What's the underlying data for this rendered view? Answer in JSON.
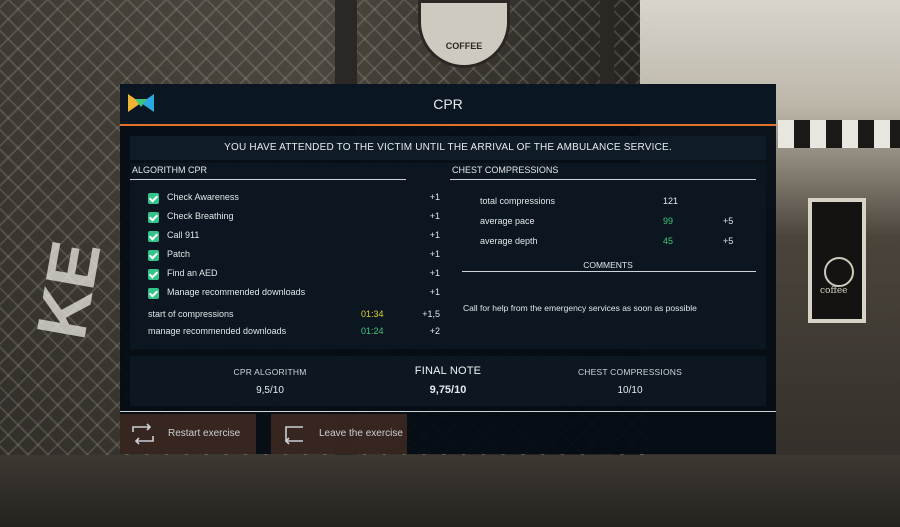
{
  "dialog": {
    "title": "CPR",
    "banner": "YOU HAVE ATTENDED TO THE VICTIM UNTIL THE ARRIVAL OF THE AMBULANCE SERVICE."
  },
  "algorithm": {
    "heading": "ALGORITHM CPR",
    "checks": [
      {
        "label": "Check Awareness",
        "points": "+1"
      },
      {
        "label": "Check Breathing",
        "points": "+1"
      },
      {
        "label": "Call 911",
        "points": "+1"
      },
      {
        "label": "Patch",
        "points": "+1"
      },
      {
        "label": "Find an AED",
        "points": "+1"
      },
      {
        "label": "Manage recommended downloads",
        "points": "+1"
      }
    ],
    "timings": [
      {
        "label": "start of compressions",
        "time": "01:34",
        "points": "+1,5",
        "color": "#e0d030"
      },
      {
        "label": "manage recommended downloads",
        "time": "01:24",
        "points": "+2",
        "color": "#3ec77a"
      }
    ]
  },
  "compressions": {
    "heading": "CHEST COMPRESSIONS",
    "rows": [
      {
        "label": "total compressions",
        "value": "121",
        "points": "",
        "color": "#e2e6e9"
      },
      {
        "label": "average pace",
        "value": "99",
        "points": "+5",
        "color": "#3ec77a"
      },
      {
        "label": "average depth",
        "value": "45",
        "points": "+5",
        "color": "#3ec77a"
      }
    ],
    "comments_heading": "COMMENTS",
    "comment": "Call for help from the emergency services as soon as possible"
  },
  "summary": {
    "algorithm_label": "CPR ALGORITHM",
    "algorithm_value": "9,5/10",
    "final_label": "FINAL NOTE",
    "final_value": "9,75/10",
    "compressions_label": "CHEST COMPRESSIONS",
    "compressions_value": "10/10"
  },
  "buttons": {
    "restart": "Restart exercise",
    "leave": "Leave the exercise"
  },
  "scene": {
    "coffee_sign": "COFFEE",
    "poster_text": "coffee",
    "graffiti": "KE"
  },
  "colors": {
    "accent": "#e0702a",
    "check": "#34c38a",
    "good": "#3ec77a",
    "warn": "#e0d030"
  }
}
